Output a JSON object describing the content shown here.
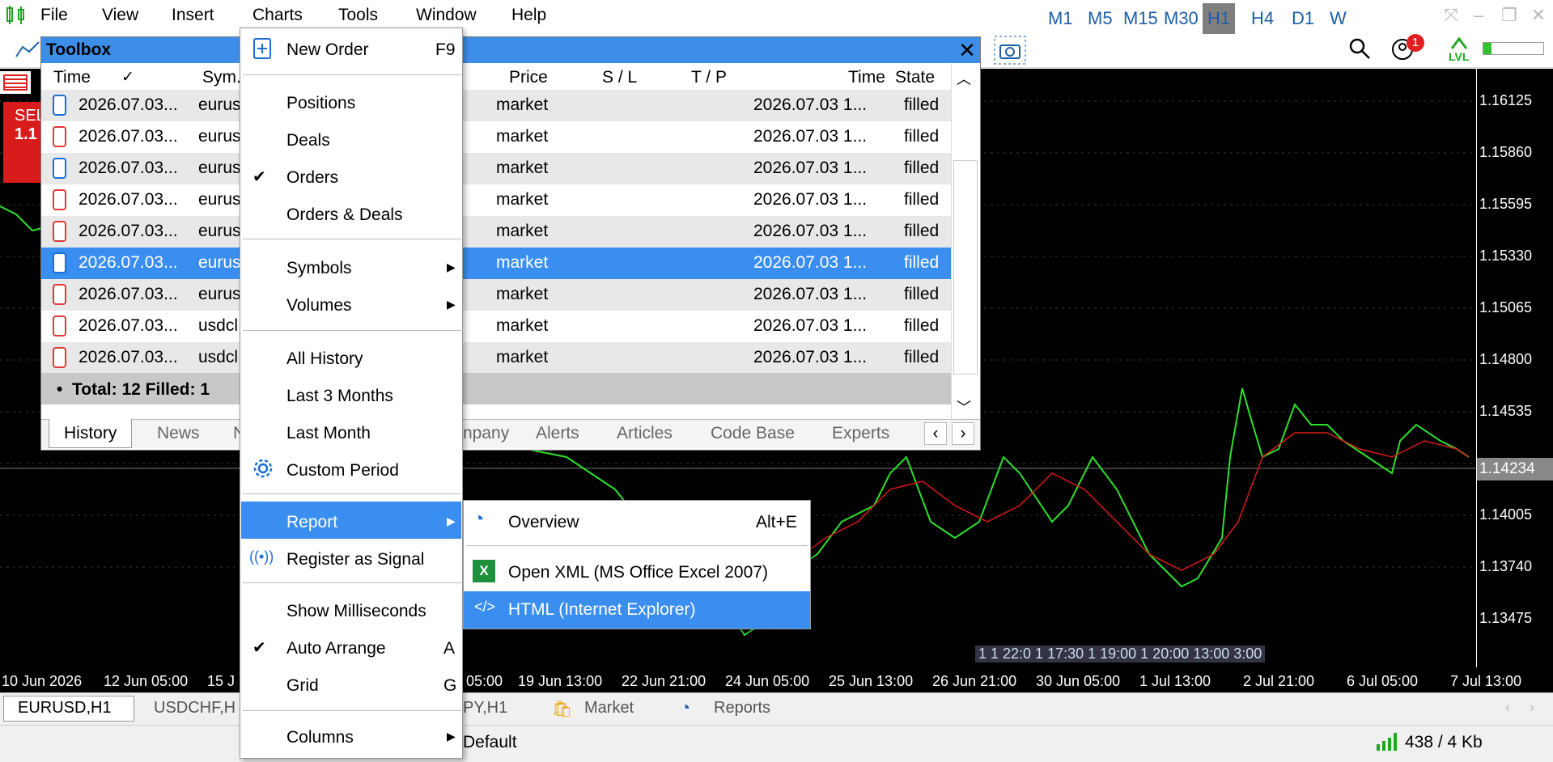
{
  "menubar": {
    "items": [
      "File",
      "View",
      "Insert",
      "Charts",
      "Tools",
      "Window",
      "Help"
    ]
  },
  "toolbar": {
    "timeframes": [
      "M1",
      "M5",
      "M15",
      "M30",
      "H1",
      "H4",
      "D1",
      "W"
    ],
    "active_timeframe": "H1",
    "notification_count": "1",
    "lvl_label": "LVL"
  },
  "chart": {
    "price_labels": [
      "1.16125",
      "1.15860",
      "1.15595",
      "1.15330",
      "1.15065",
      "1.14800",
      "1.14535",
      "1.14005",
      "1.13740",
      "1.13475"
    ],
    "current_price": "1.14234",
    "time_labels": [
      "10 Jun 2026",
      "12 Jun 05:00",
      "15 J",
      "05:00",
      "19 Jun 13:00",
      "22 Jun 21:00",
      "24 Jun 05:00",
      "25 Jun 13:00",
      "26 Jun 21:00",
      "30 Jun 05:00",
      "1 Jul 13:00",
      "2 Jul 21:00",
      "6 Jul 05:00",
      "7 Jul 13:00"
    ],
    "sell_label": "SEL",
    "sell_price": "1.1",
    "event_markers": "1 1 22:0 1 17:30 1 19:00 1 20:00 13:00 3:00"
  },
  "toolbox": {
    "title": "Toolbox",
    "columns": [
      "Time",
      "Sym...",
      "Price",
      "S / L",
      "T / P",
      "Time",
      "State"
    ],
    "rows": [
      {
        "time": "2026.07.03...",
        "symbol": "eurus",
        "price": "market",
        "time2": "2026.07.03 1...",
        "state": "filled",
        "icon": "blue"
      },
      {
        "time": "2026.07.03...",
        "symbol": "eurus",
        "price": "market",
        "time2": "2026.07.03 1...",
        "state": "filled",
        "icon": "red"
      },
      {
        "time": "2026.07.03...",
        "symbol": "eurus",
        "price": "market",
        "time2": "2026.07.03 1...",
        "state": "filled",
        "icon": "blue"
      },
      {
        "time": "2026.07.03...",
        "symbol": "eurus",
        "price": "market",
        "time2": "2026.07.03 1...",
        "state": "filled",
        "icon": "red"
      },
      {
        "time": "2026.07.03...",
        "symbol": "eurus",
        "price": "market",
        "time2": "2026.07.03 1...",
        "state": "filled",
        "icon": "red"
      },
      {
        "time": "2026.07.03...",
        "symbol": "eurus",
        "price": "market",
        "time2": "2026.07.03 1...",
        "state": "filled",
        "icon": "blue"
      },
      {
        "time": "2026.07.03...",
        "symbol": "eurus",
        "price": "market",
        "time2": "2026.07.03 1...",
        "state": "filled",
        "icon": "red"
      },
      {
        "time": "2026.07.03...",
        "symbol": "usdcl",
        "price": "market",
        "time2": "2026.07.03 1...",
        "state": "filled",
        "icon": "red"
      },
      {
        "time": "2026.07.03...",
        "symbol": "usdcl",
        "price": "market",
        "time2": "2026.07.03 1...",
        "state": "filled",
        "icon": "red"
      }
    ],
    "total_text": "Total: 12  Filled: 1",
    "tabs": [
      "History",
      "News",
      "N",
      "npany",
      "Alerts",
      "Articles",
      "Code Base",
      "Experts"
    ]
  },
  "context_menu": {
    "new_order": "New Order",
    "new_order_shortcut": "F9",
    "positions": "Positions",
    "deals": "Deals",
    "orders": "Orders",
    "orders_deals": "Orders & Deals",
    "symbols": "Symbols",
    "volumes": "Volumes",
    "all_history": "All History",
    "last_3_months": "Last 3 Months",
    "last_month": "Last Month",
    "custom_period": "Custom Period",
    "report": "Report",
    "register_signal": "Register as Signal",
    "show_ms": "Show Milliseconds",
    "auto_arrange": "Auto Arrange",
    "auto_arrange_shortcut": "A",
    "grid": "Grid",
    "grid_shortcut": "G",
    "columns": "Columns"
  },
  "submenu": {
    "overview": "Overview",
    "overview_shortcut": "Alt+E",
    "open_xml": "Open XML (MS Office Excel 2007)",
    "html": "HTML (Internet Explorer)"
  },
  "chart_tabs": [
    "EURUSD,H1",
    "USDCHF,H",
    "PY,H1",
    "Market",
    "Reports"
  ],
  "status": {
    "profile": "Default",
    "connection": "438 / 4 Kb"
  }
}
